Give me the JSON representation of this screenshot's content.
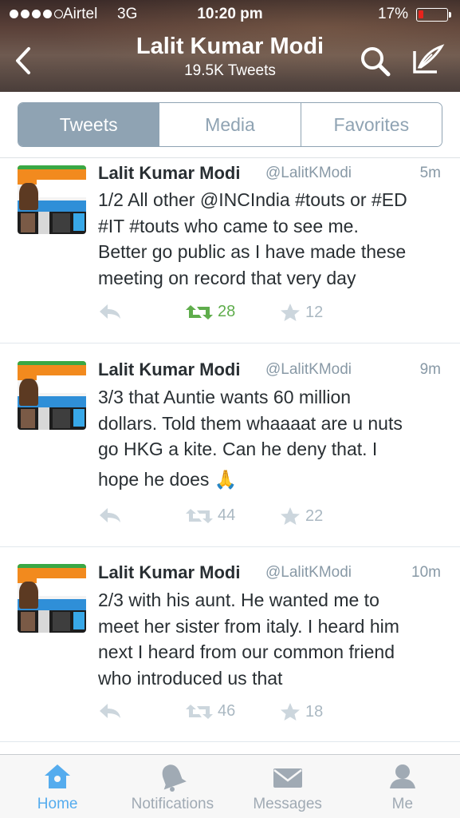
{
  "status_bar": {
    "carrier": "Airtel",
    "network": "3G",
    "time": "10:20 pm",
    "battery": "17%",
    "battery_level": 0.17
  },
  "header": {
    "title": "Lalit Kumar Modi",
    "subtitle": "19.5K Tweets",
    "back_icon": "chevron-left-icon",
    "search_icon": "search-icon",
    "compose_icon": "compose-icon"
  },
  "tabs": {
    "items": [
      {
        "label": "Tweets",
        "active": true
      },
      {
        "label": "Media",
        "active": false
      },
      {
        "label": "Favorites",
        "active": false
      }
    ]
  },
  "tweets": [
    {
      "name": "Lalit Kumar Modi",
      "handle": "@LalitKModi",
      "time": "5m",
      "lines": [
        "1/2 All other @INCIndia #touts or #ED",
        "#IT #touts who came to see me.",
        "Better go public as I have made these",
        "meeting on record that very day"
      ],
      "retweets": "28",
      "favorites": "12",
      "retweeted": true
    },
    {
      "name": "Lalit Kumar Modi",
      "handle": "@LalitKModi",
      "time": "9m",
      "lines": [
        "3/3 that Auntie wants 60 million",
        "dollars. Told them whaaaat are u nuts",
        "go HKG a kite. Can he deny that. I",
        "hope he does 🙏"
      ],
      "retweets": "44",
      "favorites": "22",
      "retweeted": false
    },
    {
      "name": "Lalit Kumar Modi",
      "handle": "@LalitKModi",
      "time": "10m",
      "lines": [
        "2/3 with his aunt. He wanted me to",
        "meet her sister from italy. I heard him",
        "next I heard from our common friend",
        "who introduced us that"
      ],
      "retweets": "46",
      "favorites": "18",
      "retweeted": false
    }
  ],
  "tabbar": {
    "items": [
      {
        "label": "Home",
        "icon": "home-icon",
        "active": true
      },
      {
        "label": "Notifications",
        "icon": "bell-icon",
        "active": false
      },
      {
        "label": "Messages",
        "icon": "envelope-icon",
        "active": false
      },
      {
        "label": "Me",
        "icon": "person-icon",
        "active": false
      }
    ]
  },
  "colors": {
    "accent": "#55acee",
    "retweet_green": "#5fad4c",
    "segment": "#8fa3b3",
    "muted": "#8899a6"
  }
}
